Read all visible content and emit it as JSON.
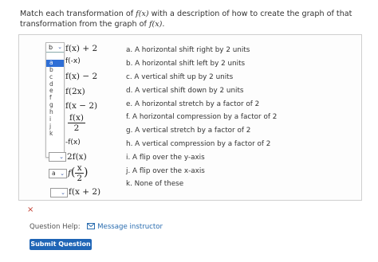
{
  "question": {
    "prompt_part1": "Match each transformation of ",
    "prompt_f": "f(x)",
    "prompt_part2": " with a description of how to create the graph of that transformation from the graph of ",
    "prompt_f2": "f(x)",
    "prompt_end": "."
  },
  "dropdown_open": {
    "selected": "b",
    "options": [
      "",
      "a",
      "b",
      "c",
      "d",
      "e",
      "f",
      "g",
      "h",
      "i",
      "j",
      "k"
    ],
    "highlighted": "a"
  },
  "transformations": [
    {
      "label": "f(x) + 2"
    },
    {
      "label": "f(-x)"
    },
    {
      "label": "f(x) − 2"
    },
    {
      "label": "f(2x)"
    },
    {
      "label": "f(x − 2)"
    },
    {
      "label_num": "f(x)",
      "label_den": "2"
    },
    {
      "label": "-f(x)"
    },
    {
      "label": "2f(x)",
      "selected": ""
    },
    {
      "label_pre": "f",
      "label_num": "x",
      "label_den": "2",
      "selected": "a"
    },
    {
      "label": "f(x + 2)",
      "selected": ""
    }
  ],
  "descriptions": [
    "a. A horizontal shift right by 2 units",
    "b. A horizontal shift left by 2 units",
    "c. A vertical shift up by 2 units",
    "d. A vertical shift down by 2 units",
    "e. A horizontal stretch by a factor of 2",
    "f. A horizontal compression by a factor of 2",
    "g. A vertical stretch by a factor of 2",
    "h. A vertical compression by a factor of 2",
    "i. A flip over the y-axis",
    "j. A flip over the x-axis",
    "k. None of these"
  ],
  "status": {
    "wrong_mark": "×"
  },
  "help": {
    "label": "Question Help:",
    "message_link": "Message instructor"
  },
  "submit": {
    "label": "Submit Question"
  },
  "colors": {
    "accent": "#1f65b6",
    "highlight": "#2f6fd6",
    "wrong": "#c0392b"
  }
}
